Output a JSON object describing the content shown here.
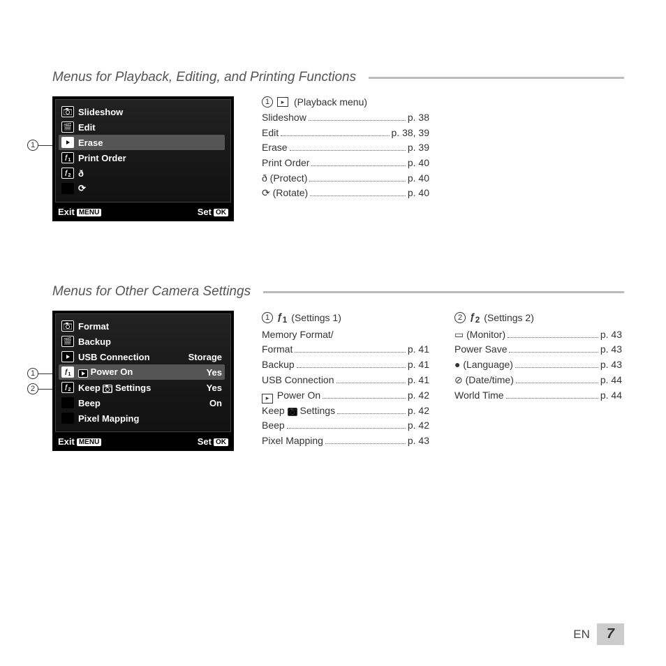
{
  "section1": {
    "title": "Menus for Playback, Editing, and Printing Functions",
    "screen": {
      "items": [
        {
          "icon": "camera",
          "label": "Slideshow"
        },
        {
          "icon": "movie",
          "label": "Edit"
        },
        {
          "icon": "play",
          "label": "Erase",
          "selected": true
        },
        {
          "icon": "tool1",
          "label": "Print Order"
        },
        {
          "icon": "tool2",
          "label_glyph": "protect"
        },
        {
          "icon": "",
          "label_glyph": "rotate"
        }
      ],
      "exit": "Exit",
      "exit_btn": "MENU",
      "set": "Set",
      "set_btn": "OK"
    },
    "callout": "1",
    "refs": [
      {
        "num": "1",
        "head_icon": "play",
        "head_text": "(Playback menu)",
        "lines": [
          {
            "n": "Slideshow",
            "p": "p. 38"
          },
          {
            "n": "Edit",
            "p": "p. 38, 39"
          },
          {
            "n": "Erase",
            "p": "p. 39"
          },
          {
            "n": "Print Order",
            "p": "p. 40"
          },
          {
            "n_glyph": "protect",
            "n_suffix": " (Protect)",
            "p": "p. 40"
          },
          {
            "n_glyph": "rotate",
            "n_suffix": " (Rotate)",
            "p": "p. 40"
          }
        ]
      }
    ]
  },
  "section2": {
    "title": "Menus for Other Camera Settings",
    "screen": {
      "items": [
        {
          "icon": "camera",
          "label": "Format"
        },
        {
          "icon": "movie",
          "label": "Backup"
        },
        {
          "icon": "play",
          "label": "USB Connection",
          "val": "Storage"
        },
        {
          "icon": "tool1",
          "label_prefix_icon": "play",
          "label": "Power On",
          "val": "Yes",
          "selected": true
        },
        {
          "icon": "tool2",
          "label_prefix_text": "Keep ",
          "label_prefix_icon": "camera",
          "label": " Settings",
          "val": "Yes"
        },
        {
          "icon": "",
          "label": "Beep",
          "val": "On"
        },
        {
          "icon": "",
          "label": "Pixel Mapping"
        }
      ],
      "exit": "Exit",
      "exit_btn": "MENU",
      "set": "Set",
      "set_btn": "OK"
    },
    "callouts": [
      "1",
      "2"
    ],
    "refs": [
      {
        "num": "1",
        "head_glyph": "tool1",
        "head_text": "(Settings 1)",
        "lines": [
          {
            "n": "Memory Format/",
            "nobreak": true
          },
          {
            "n": "Format",
            "p": "p. 41"
          },
          {
            "n": "Backup",
            "p": "p. 41"
          },
          {
            "n": "USB Connection",
            "p": "p. 41"
          },
          {
            "n_icon": "play",
            "n_suffix": " Power On",
            "p": "p. 42"
          },
          {
            "n": "Keep ",
            "n_icon_mid": "camera",
            "n_suffix": " Settings",
            "p": "p. 42"
          },
          {
            "n": "Beep",
            "p": "p. 42"
          },
          {
            "n": "Pixel Mapping",
            "p": "p. 43"
          }
        ]
      },
      {
        "num": "2",
        "head_glyph": "tool2",
        "head_text": "(Settings 2)",
        "lines": [
          {
            "n_glyph": "monitor",
            "n_suffix": " (Monitor)",
            "p": "p. 43"
          },
          {
            "n": "Power Save",
            "p": "p. 43"
          },
          {
            "n_glyph": "language",
            "n_suffix": " (Language)",
            "p": "p. 43"
          },
          {
            "n_glyph": "clock",
            "n_suffix": " (Date/time)",
            "p": "p. 44"
          },
          {
            "n": "World Time",
            "p": "p. 44"
          }
        ]
      }
    ]
  },
  "footer": {
    "lang": "EN",
    "page": "7"
  }
}
